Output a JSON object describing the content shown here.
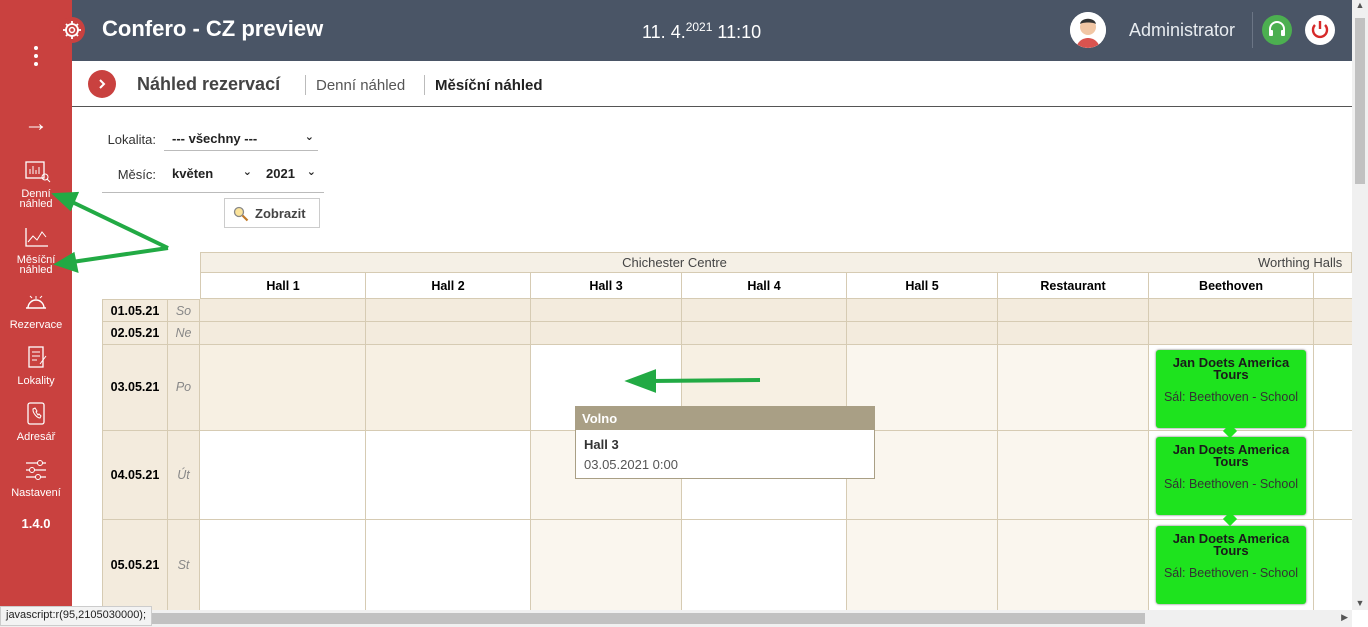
{
  "app": {
    "title": "Confero - CZ preview",
    "date": "11. 4.",
    "year": "2021",
    "time": "11:10",
    "user": "Administrator"
  },
  "sidebar": {
    "items": [
      {
        "label1": "Denní",
        "label2": "náhled"
      },
      {
        "label1": "Měsíční",
        "label2": "náhled"
      },
      {
        "label1": "Rezervace",
        "label2": ""
      },
      {
        "label1": "Lokality",
        "label2": ""
      },
      {
        "label1": "Adresář",
        "label2": ""
      },
      {
        "label1": "Nastavení",
        "label2": ""
      }
    ],
    "version": "1.4.0"
  },
  "breadcrumb": {
    "title": "Náhled rezervací",
    "link1": "Denní náhled",
    "link2": "Měsíční náhled"
  },
  "filters": {
    "location_label": "Lokalita:",
    "location_value": "--- všechny ---",
    "month_label": "Měsíc:",
    "month_value": "květen",
    "year_value": "2021",
    "show_button": "Zobrazit"
  },
  "grid": {
    "groups": [
      "Chichester Centre",
      "Worthing Halls"
    ],
    "halls": [
      "Hall 1",
      "Hall 2",
      "Hall 3",
      "Hall 4",
      "Hall 5",
      "Restaurant",
      "Beethoven"
    ],
    "rows": [
      {
        "date": "01.05.21",
        "day": "So"
      },
      {
        "date": "02.05.21",
        "day": "Ne"
      },
      {
        "date": "03.05.21",
        "day": "Po"
      },
      {
        "date": "04.05.21",
        "day": "Út"
      },
      {
        "date": "05.05.21",
        "day": "St"
      }
    ],
    "events": [
      {
        "title": "Jan Doets America Tours",
        "subtitle": "Sál: Beethoven - School"
      },
      {
        "title": "Jan Doets America Tours",
        "subtitle": "Sál: Beethoven - School"
      },
      {
        "title": "Jan Doets America Tours",
        "subtitle": "Sál: Beethoven - School"
      }
    ]
  },
  "tooltip": {
    "header": "Volno",
    "name": "Hall 3",
    "datetime": "03.05.2021 0:00"
  },
  "status": "javascript:r(95,2105030000);",
  "colors": {
    "sidebar": "#c9413f",
    "topbar": "#4a5566",
    "event": "#1ee31e",
    "weekend": "#f3ebdd",
    "arrow": "#22aa44"
  }
}
